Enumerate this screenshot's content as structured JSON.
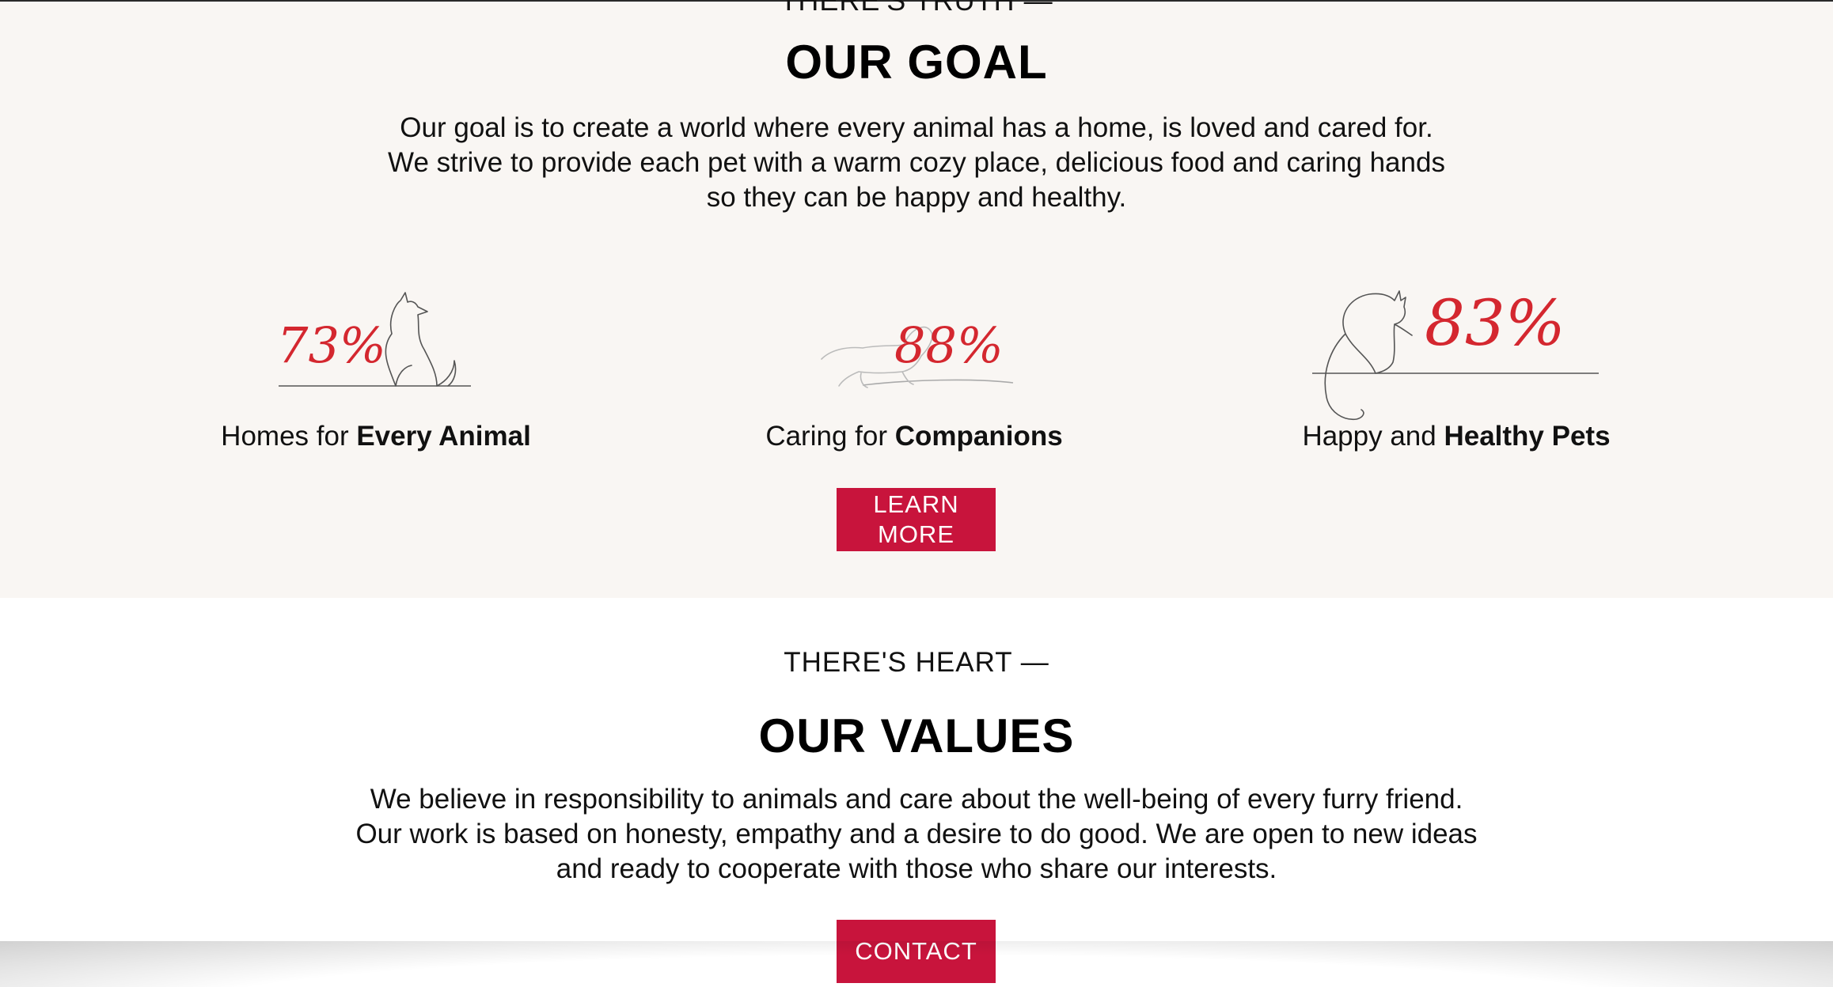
{
  "top_eyebrow_partial": "THERE'S TRUTH —",
  "goal": {
    "title": "OUR GOAL",
    "text": "Our goal is to create a world where every animal has a home, is loved and cared for. We strive to provide each pet with a warm cozy place, delicious food and caring hands so they can be happy and healthy.",
    "stats": [
      {
        "value": "73%",
        "caption_prefix": "Homes for ",
        "caption_bold": "Every Animal",
        "icon": "sitting-dog-line-icon"
      },
      {
        "value": "88%",
        "caption_prefix": "Caring for ",
        "caption_bold": "Companions",
        "icon": "dachshund-line-icon"
      },
      {
        "value": "83%",
        "caption_prefix": "Happy and ",
        "caption_bold": "Healthy Pets",
        "icon": "cat-line-icon"
      }
    ],
    "button_line1": "LEARN",
    "button_line2": "MORE"
  },
  "values": {
    "eyebrow": "THERE'S HEART —",
    "title": "OUR VALUES",
    "text": "We believe in responsibility to animals and care about the well-being of every furry friend. Our work is based on honesty, empathy and a desire to do good. We are open to new ideas and ready to cooperate with those who share our interests.",
    "button": "CONTACT"
  },
  "colors": {
    "accent": "#c8143c",
    "stat_red": "#d4272f",
    "goal_bg": "#f9f6f3"
  }
}
